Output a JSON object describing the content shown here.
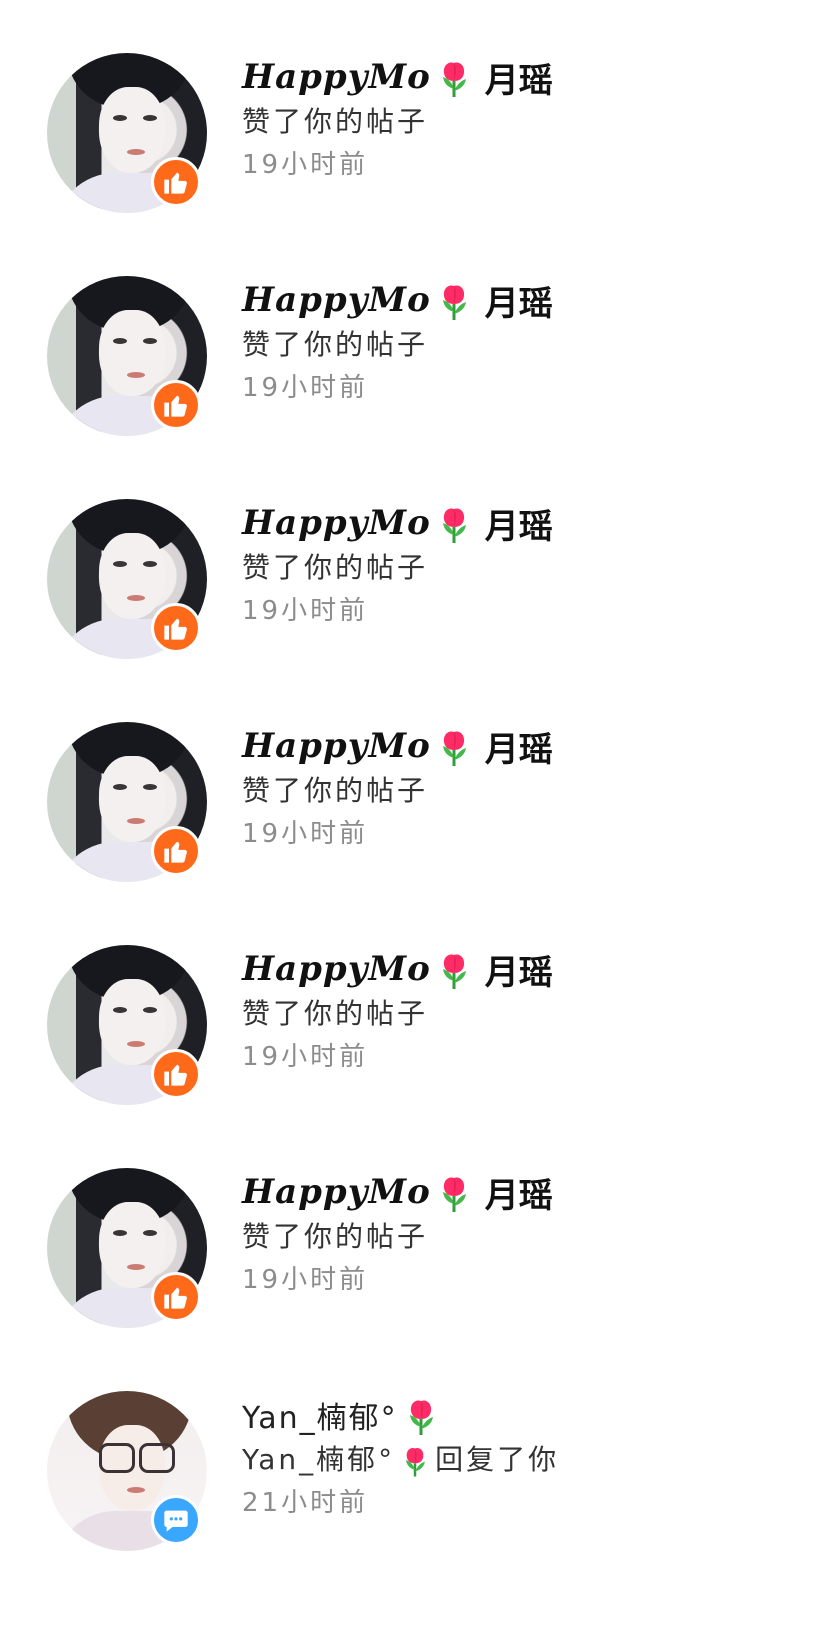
{
  "notifications": [
    {
      "type": "like",
      "name_latin": "HappyMo",
      "name_suffix": "月瑶",
      "emoji": "tulip",
      "action": "赞了你的帖子",
      "time": "19小时前"
    },
    {
      "type": "like",
      "name_latin": "HappyMo",
      "name_suffix": "月瑶",
      "emoji": "tulip",
      "action": "赞了你的帖子",
      "time": "19小时前"
    },
    {
      "type": "like",
      "name_latin": "HappyMo",
      "name_suffix": "月瑶",
      "emoji": "tulip",
      "action": "赞了你的帖子",
      "time": "19小时前"
    },
    {
      "type": "like",
      "name_latin": "HappyMo",
      "name_suffix": "月瑶",
      "emoji": "tulip",
      "action": "赞了你的帖子",
      "time": "19小时前"
    },
    {
      "type": "like",
      "name_latin": "HappyMo",
      "name_suffix": "月瑶",
      "emoji": "tulip",
      "action": "赞了你的帖子",
      "time": "19小时前"
    },
    {
      "type": "like",
      "name_latin": "HappyMo",
      "name_suffix": "月瑶",
      "emoji": "tulip",
      "action": "赞了你的帖子",
      "time": "19小时前"
    },
    {
      "type": "reply",
      "name": "Yan_楠郁°",
      "emoji": "tulip",
      "action_prefix": "Yan_楠郁°",
      "action_suffix": "回复了你",
      "time": "21小时前"
    }
  ],
  "colors": {
    "like_badge": "#ff6a1a",
    "reply_badge": "#3aa7ff",
    "time_text": "#8c8c8c"
  },
  "icons": {
    "like_badge": "thumbs-up-icon",
    "reply_badge": "speech-bubble-icon",
    "emoji": "tulip-icon"
  }
}
